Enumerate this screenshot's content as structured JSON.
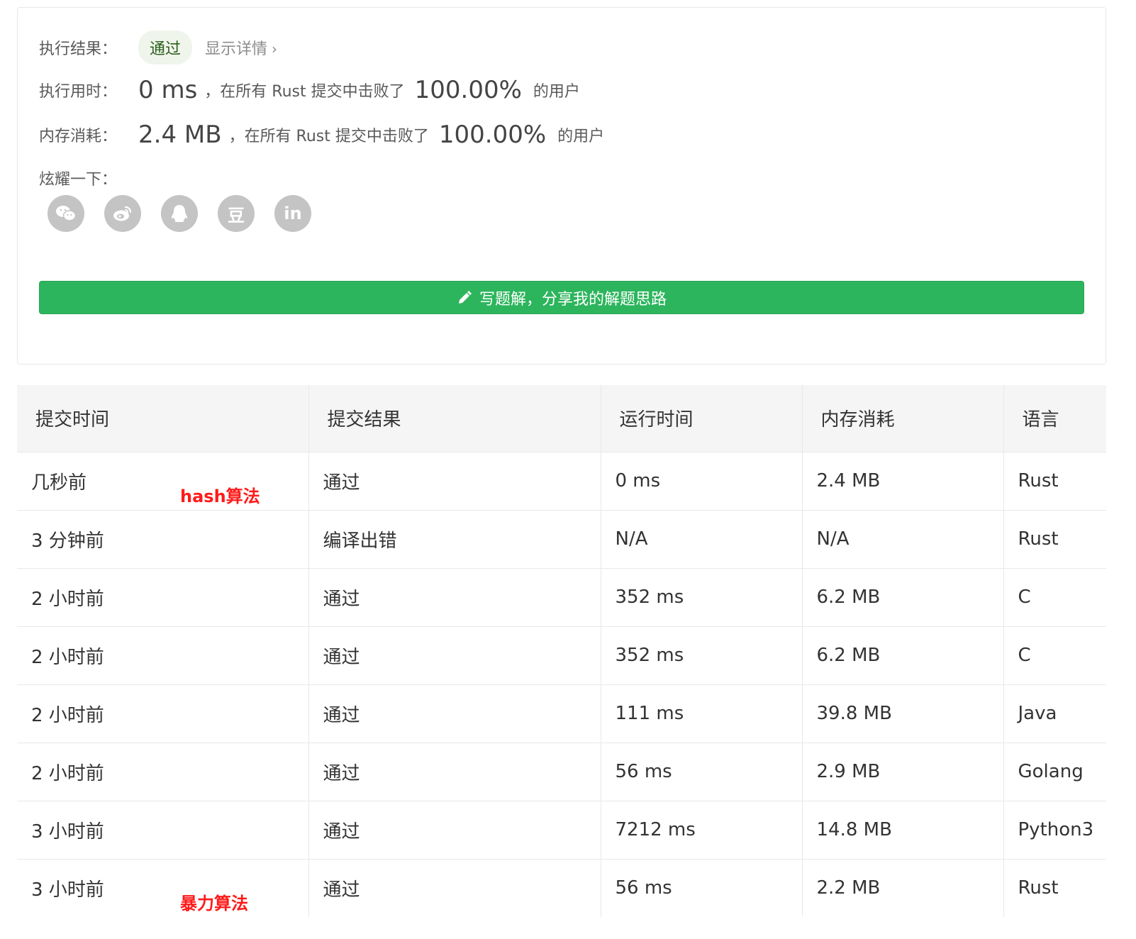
{
  "summary": {
    "result_label": "执行结果：",
    "result_badge": "通过",
    "details_link": "显示详情",
    "details_chevron": "›",
    "time_label": "执行用时：",
    "time_value": "0 ms",
    "time_beat_text": "，在所有 Rust 提交中击败了",
    "time_percent": "100.00%",
    "time_users": "的用户",
    "memory_label": "内存消耗：",
    "memory_value": "2.4 MB",
    "memory_beat_text": "，在所有 Rust 提交中击败了",
    "memory_percent": "100.00%",
    "memory_users": "的用户",
    "share_label": "炫耀一下：",
    "share_icons": [
      "wechat-icon",
      "weibo-icon",
      "qq-icon",
      "douban-icon",
      "linkedin-icon"
    ],
    "share_douban_glyph": "豆",
    "share_linkedin_glyph": "in",
    "solution_button": "写题解，分享我的解题思路"
  },
  "table": {
    "headers": [
      "提交时间",
      "提交结果",
      "运行时间",
      "内存消耗",
      "语言"
    ],
    "rows": [
      {
        "time": "几秒前",
        "status": "通过",
        "status_type": "pass",
        "runtime": "0 ms",
        "memory": "2.4 MB",
        "lang": "Rust",
        "note": "hash算法"
      },
      {
        "time": "3 分钟前",
        "status": "编译出错",
        "status_type": "error",
        "runtime": "N/A",
        "memory": "N/A",
        "lang": "Rust",
        "note": ""
      },
      {
        "time": "2 小时前",
        "status": "通过",
        "status_type": "pass",
        "runtime": "352 ms",
        "memory": "6.2 MB",
        "lang": "C",
        "note": ""
      },
      {
        "time": "2 小时前",
        "status": "通过",
        "status_type": "pass",
        "runtime": "352 ms",
        "memory": "6.2 MB",
        "lang": "C",
        "note": ""
      },
      {
        "time": "2 小时前",
        "status": "通过",
        "status_type": "pass",
        "runtime": "111 ms",
        "memory": "39.8 MB",
        "lang": "Java",
        "note": ""
      },
      {
        "time": "2 小时前",
        "status": "通过",
        "status_type": "pass",
        "runtime": "56 ms",
        "memory": "2.9 MB",
        "lang": "Golang",
        "note": ""
      },
      {
        "time": "3 小时前",
        "status": "通过",
        "status_type": "pass",
        "runtime": "7212 ms",
        "memory": "14.8 MB",
        "lang": "Python3",
        "note": ""
      },
      {
        "time": "3 小时前",
        "status": "通过",
        "status_type": "pass",
        "runtime": "56 ms",
        "memory": "2.2 MB",
        "lang": "Rust",
        "note": "暴力算法"
      }
    ]
  },
  "colors": {
    "pass": "#5cb72d",
    "error": "#e0423b",
    "note": "#ff1a1a",
    "solution_button": "#2db55d"
  }
}
